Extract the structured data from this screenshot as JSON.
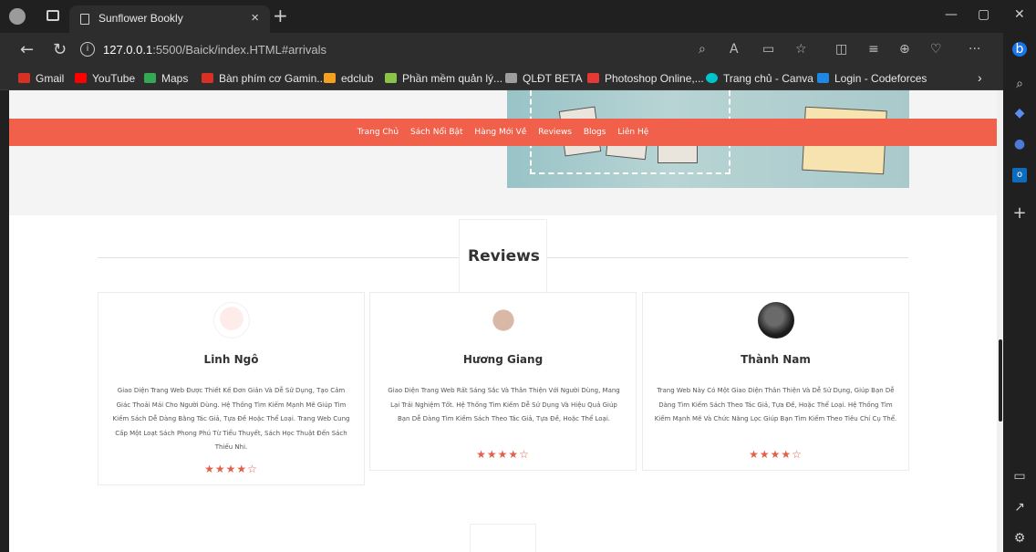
{
  "browser": {
    "tab_title": "Sunflower Bookly",
    "tab_close": "×",
    "new_tab": "+",
    "url_host": "127.0.0.1",
    "url_rest": ":5500/Baick/index.HTML#arrivals",
    "more": "···"
  },
  "bookmarks": [
    {
      "label": "Gmail",
      "color": "#d93025"
    },
    {
      "label": "YouTube",
      "color": "#ff0000"
    },
    {
      "label": "Maps",
      "color": "#34a853"
    },
    {
      "label": "Bàn phím cơ Gamin...",
      "color": "#d93025"
    },
    {
      "label": "edclub",
      "color": "#f4a020"
    },
    {
      "label": "Phần mềm quản lý...",
      "color": "#8bc34a"
    },
    {
      "label": "QLĐT BETA",
      "color": "#9e9e9e"
    },
    {
      "label": "Photoshop Online,...",
      "color": "#e53935"
    },
    {
      "label": "Trang chủ - Canva",
      "color": "#00c4cc"
    },
    {
      "label": "Login - Codeforces",
      "color": "#1e88e5"
    }
  ],
  "site_nav": [
    "Trang Chủ",
    "Sách Nổi Bật",
    "Hàng Mới Về",
    "Reviews",
    "Blogs",
    "Liên Hệ"
  ],
  "reviews": {
    "title": "Reviews",
    "cards": [
      {
        "name": "Linh Ngô",
        "text": "Giao Diện Trang Web Được Thiết Kế Đơn Giản Và Dễ Sử Dụng, Tạo Cảm Giác Thoải Mái Cho Người Dùng. Hệ Thống Tìm Kiếm Mạnh Mẽ Giúp Tìm Kiếm Sách Dễ Dàng Bằng Tác Giả, Tựa Đề Hoặc Thể Loại. Trang Web Cung Cấp Một Loạt Sách Phong Phú Từ Tiểu Thuyết, Sách Học Thuật Đến Sách Thiếu Nhi.",
        "stars": "★★★★☆"
      },
      {
        "name": "Hương Giang",
        "text": "Giao Diện Trang Web Rất Sáng Sắc Và Thân Thiện Với Người Dùng, Mang Lại Trải Nghiệm Tốt. Hệ Thống Tìm Kiếm Dễ Sử Dụng Và Hiệu Quả Giúp Bạn Dễ Dàng Tìm Kiếm Sách Theo Tác Giả, Tựa Đề, Hoặc Thể Loại.",
        "stars": "★★★★☆"
      },
      {
        "name": "Thành Nam",
        "text": "Trang Web Này Có Một Giao Diện Thân Thiện Và Dễ Sử Dụng, Giúp Bạn Dễ Dàng Tìm Kiếm Sách Theo Tác Giả, Tựa Đề, Hoặc Thể Loại. Hệ Thống Tìm Kiếm Mạnh Mẽ Và Chức Năng Lọc Giúp Bạn Tìm Kiếm Theo Tiêu Chí Cụ Thể.",
        "stars": "★★★★☆"
      }
    ]
  }
}
